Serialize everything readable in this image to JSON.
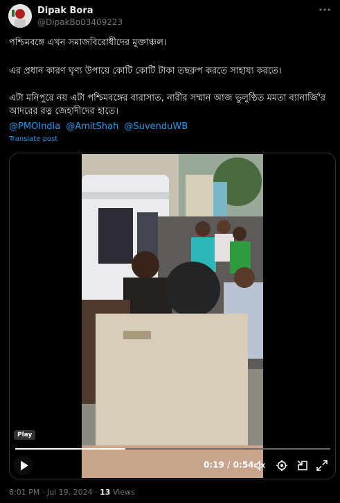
{
  "author": {
    "name": "Dipak Bora",
    "handle": "@DipakBo03409223"
  },
  "post": {
    "line1": "পশ্চিমবঙ্গে এখন সমাজবিরোধীদের মুক্তাঞ্চল।",
    "line2": "এর প্রধান কারণ ঘৃণ্য উপায়ে কোটি কোটি টাকা তছরুপ করতে সাহায্য করতে।",
    "line3": "এটা মনিপুরে নয় এটা পশ্চিমবঙ্গের বারাসাত, নারীর সম্মান আজ ভুলুণ্ঠিত মমতা ব্যানার্জি'র আদরের রত্ন জেহাদীদের হাতে।",
    "mentions": [
      "@PMOIndia",
      "@AmitShah",
      "@SuvenduWB"
    ],
    "translate_label": "Translate post"
  },
  "video": {
    "badge": "Play",
    "current_time": "0:19",
    "separator": "/",
    "duration": "0:54",
    "time_display": "0:19 / 0:54",
    "progress_fraction": 0.35
  },
  "meta": {
    "time": "8:01 PM",
    "dot1": "·",
    "date": "Jul 19, 2024",
    "dot2": "·",
    "views_count": "13",
    "views_label": "Views"
  },
  "icons": {
    "more": "more-icon",
    "play": "play-icon",
    "volume": "volume-muted-icon",
    "settings": "settings-icon",
    "pip": "pip-icon",
    "fullscreen": "fullscreen-icon"
  }
}
